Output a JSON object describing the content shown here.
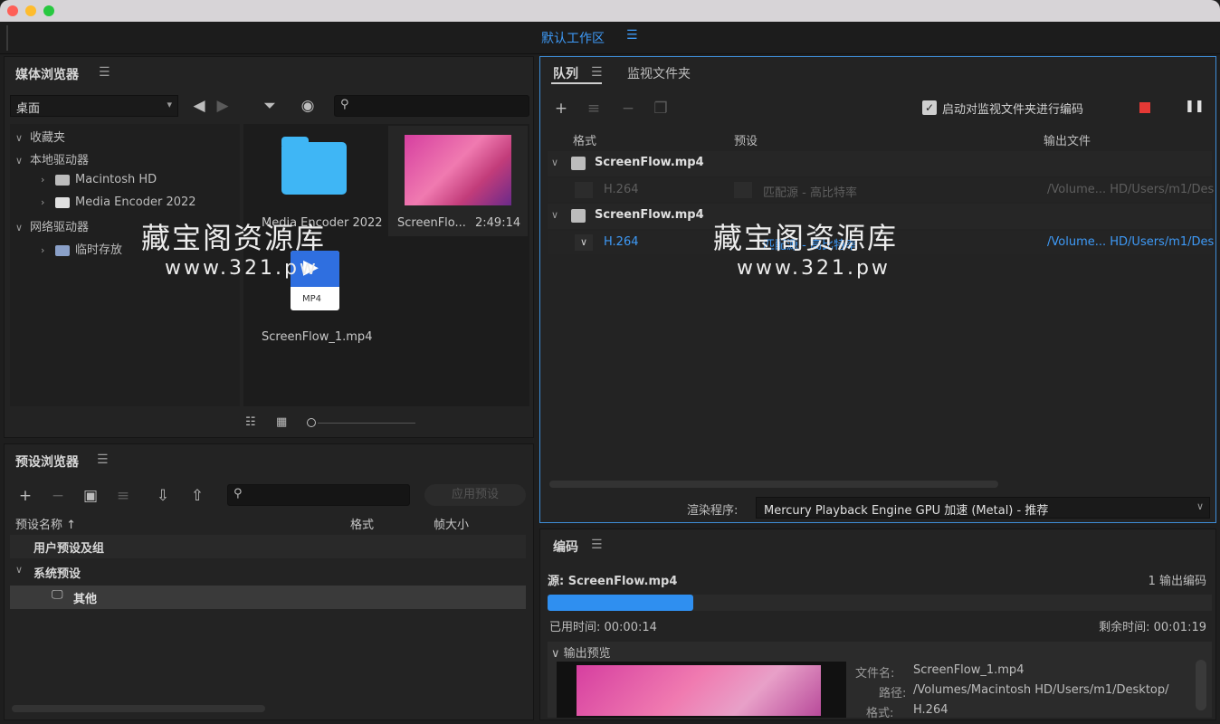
{
  "workspace": {
    "title": "默认工作区"
  },
  "media_browser": {
    "title": "媒体浏览器",
    "location": "桌面",
    "tree": {
      "favorites": "收藏夹",
      "local_drives": "本地驱动器",
      "drive1": "Macintosh HD",
      "drive2": "Media Encoder 2022",
      "network_drives": "网络驱动器",
      "temp": "临时存放"
    },
    "items": [
      {
        "name": "Media Encoder 2022",
        "type": "folder"
      },
      {
        "name": "ScreenFlo...",
        "duration": "2:49:14",
        "type": "video"
      },
      {
        "name": "ScreenFlow_1.mp4",
        "type": "mp4",
        "badge": "MP4"
      }
    ]
  },
  "preset_browser": {
    "title": "预设浏览器",
    "apply_label": "应用预设",
    "columns": {
      "name": "预设名称",
      "format": "格式",
      "frame_size": "帧大小"
    },
    "user_group": "用户预设及组",
    "system_group": "系统预设",
    "other": "其他"
  },
  "queue": {
    "tab_queue": "队列",
    "tab_watch": "监视文件夹",
    "auto_encode_label": "启动对监视文件夹进行编码",
    "columns": {
      "format": "格式",
      "preset": "预设",
      "output": "输出文件"
    },
    "items": [
      {
        "source": "ScreenFlow.mp4",
        "format": "H.264",
        "preset": "匹配源 - 高比特率",
        "output": "/Volume... HD/Users/m1/Des"
      },
      {
        "source": "ScreenFlow.mp4",
        "format": "H.264",
        "preset": "匹配源 - 高比特率",
        "output": "/Volume... HD/Users/m1/Des"
      }
    ],
    "renderer_label": "渲染程序:",
    "renderer_value": "Mercury Playback Engine GPU 加速 (Metal) - 推荐"
  },
  "encoding": {
    "title": "编码",
    "source": "源: ScreenFlow.mp4",
    "outputs": "1 输出编码",
    "progress": 0.22,
    "elapsed": "已用时间: 00:00:14",
    "remaining": "剩余时间: 00:01:19",
    "output_preview": "输出预览",
    "file_label": "文件名:",
    "file_value": "ScreenFlow_1.mp4",
    "path_label": "路径:",
    "path_value": "/Volumes/Macintosh HD/Users/m1/Desktop/",
    "format_label": "格式:",
    "format_value": "H.264"
  },
  "watermark": {
    "text": "藏宝阁资源库",
    "url": "www.321.pw"
  },
  "colors": {
    "accent": "#3e9af7",
    "stop": "#e53935",
    "progress": "#2f8ff0"
  }
}
